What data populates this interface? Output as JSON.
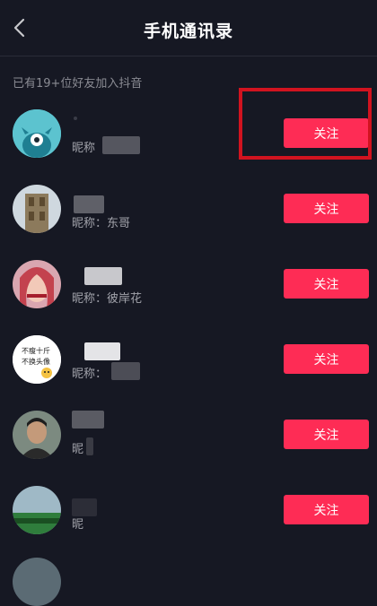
{
  "header": {
    "title": "手机通讯录",
    "back_icon": "chevron-left-icon"
  },
  "subtitle": "已有19+位好友加入抖音",
  "contacts": [
    {
      "nickname_label": "昵称",
      "nickname_value": "",
      "follow_label": "关注"
    },
    {
      "nickname_label": "昵称：东哥",
      "nickname_value": "东哥",
      "follow_label": "关注"
    },
    {
      "nickname_label": "昵称：彼岸花",
      "nickname_value": "彼岸花",
      "follow_label": "关注"
    },
    {
      "nickname_label": "昵称：",
      "nickname_value": "",
      "follow_label": "关注"
    },
    {
      "nickname_label": "昵",
      "nickname_value": "",
      "follow_label": "关注"
    },
    {
      "nickname_label": "昵",
      "nickname_value": "",
      "follow_label": "关注"
    }
  ],
  "avatar_text": {
    "line1": "不瘦十斤",
    "line2": "不换头像"
  },
  "colors": {
    "background": "#161823",
    "follow_button": "#fe2c55",
    "highlight_box": "#d1131f"
  }
}
